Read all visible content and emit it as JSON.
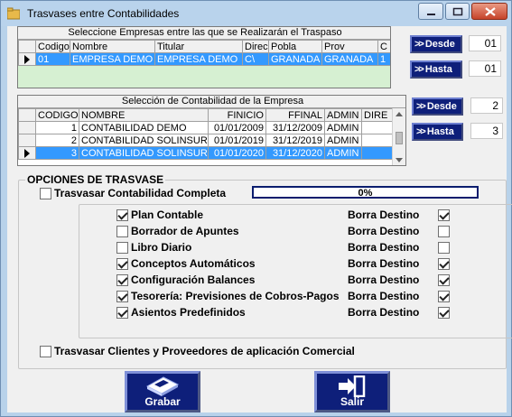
{
  "window": {
    "title": "Trasvases entre Contabilidades",
    "icons": {
      "app": "folder-icon",
      "minimize": "minimize-icon",
      "maximize": "maximize-icon",
      "close": "close-icon"
    }
  },
  "empresas": {
    "caption": "Seleccione Empresas entre las que se Realizarán el Traspaso",
    "columns": [
      "Codigo",
      "Nombre",
      "Titular",
      "Direc",
      "Pobla",
      "Prov",
      "C"
    ],
    "rows": [
      {
        "codigo": "01",
        "nombre": "EMPRESA DEMO",
        "titular": "EMPRESA DEMO",
        "direc": "C\\",
        "pobla": "GRANADA",
        "prov": "GRANADA",
        "c": "1"
      }
    ]
  },
  "contabilidades": {
    "caption": "Selección de Contabilidad de la Empresa",
    "columns": [
      "CODIGO",
      "NOMBRE",
      "FINICIO",
      "FFINAL",
      "ADMIN",
      "DIRE"
    ],
    "rows": [
      {
        "codigo": "1",
        "nombre": "CONTABILIDAD DEMO",
        "finicio": "01/01/2009",
        "ffinal": "31/12/2009",
        "admin": "ADMIN"
      },
      {
        "codigo": "2",
        "nombre": "CONTABILIDAD SOLINSUR",
        "finicio": "01/01/2019",
        "ffinal": "31/12/2019",
        "admin": "ADMIN"
      },
      {
        "codigo": "3",
        "nombre": "CONTABILIDAD SOLINSUR",
        "finicio": "01/01/2020",
        "ffinal": "31/12/2020",
        "admin": "ADMIN"
      }
    ]
  },
  "empresa_range": {
    "desde_label": "Desde",
    "desde_value": "01",
    "hasta_label": "Hasta",
    "hasta_value": "01"
  },
  "contab_range": {
    "desde_label": "Desde",
    "desde_value": "2",
    "hasta_label": "Hasta",
    "hasta_value": "3"
  },
  "opciones": {
    "title": "OPCIONES DE TRASVASE",
    "completa_label": "Trasvasar Contabilidad Completa",
    "completa_checked": false,
    "progress_text": "0%",
    "progress_value": 0,
    "borra_label": "Borra Destino",
    "items": [
      {
        "label": "Plan Contable",
        "checked": true,
        "borra_checked": true
      },
      {
        "label": "Borrador de Apuntes",
        "checked": false,
        "borra_checked": false
      },
      {
        "label": "Libro Diario",
        "checked": false,
        "borra_checked": false
      },
      {
        "label": "Conceptos Automáticos",
        "checked": true,
        "borra_checked": true
      },
      {
        "label": "Configuración Balances",
        "checked": true,
        "borra_checked": true
      },
      {
        "label": "Tesorería: Previsiones de Cobros-Pagos",
        "checked": true,
        "borra_checked": true
      },
      {
        "label": "Asientos Predefinidos",
        "checked": true,
        "borra_checked": true
      }
    ],
    "clientes_label": "Trasvasar Clientes y Proveedores de aplicación Comercial",
    "clientes_checked": false
  },
  "buttons": {
    "grabar": "Grabar",
    "salir": "Salir",
    "grabar_icon": "floppy-disk-icon",
    "salir_icon": "exit-door-icon"
  },
  "colors": {
    "navy": "#0e1f7a",
    "selection": "#3399ff",
    "titlebar": "#b9d3ec"
  }
}
